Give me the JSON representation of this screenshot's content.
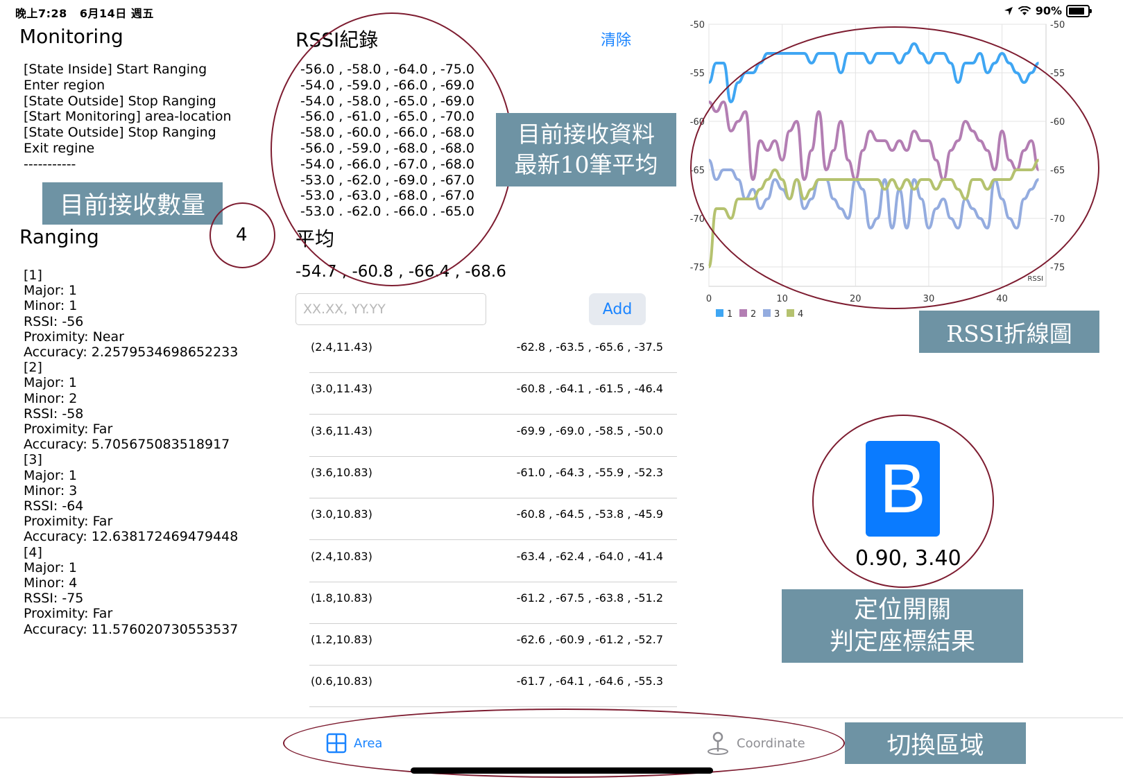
{
  "status_bar": {
    "time": "晚上7:28",
    "date": "6月14日 週五",
    "battery": "90%",
    "battery_level": 0.9
  },
  "monitoring": {
    "title": "Monitoring",
    "log": "[State Inside] Start Ranging\nEnter region\n[State Outside] Stop Ranging\n[Start Monitoring] area-location\n[State Outside] Stop Ranging\nExit regine\n-----------"
  },
  "ranging": {
    "title": "Ranging",
    "count": "4",
    "text": "[1]\nMajor: 1\nMinor: 1\nRSSI: -56\nProximity: Near\nAccuracy: 2.2579534698652233\n[2]\nMajor: 1\nMinor: 2\nRSSI: -58\nProximity: Far\nAccuracy: 5.705675083518917\n[3]\nMajor: 1\nMinor: 3\nRSSI: -64\nProximity: Far\nAccuracy: 12.638172469479448\n[4]\nMajor: 1\nMinor: 4\nRSSI: -75\nProximity: Far\nAccuracy: 11.576020730553537"
  },
  "rssi_log": {
    "title": "RSSI紀錄",
    "clear_label": "清除",
    "lines": "-56.0 , -58.0 , -64.0 , -75.0\n-54.0 , -59.0 , -66.0 , -69.0\n-54.0 , -58.0 , -65.0 , -69.0\n-56.0 , -61.0 , -65.0 , -70.0\n-58.0 , -60.0 , -66.0 , -68.0\n-56.0 , -59.0 , -68.0 , -68.0\n-54.0 , -66.0 , -67.0 , -68.0\n-53.0 , -62.0 , -69.0 , -67.0\n-53.0 , -63.0 , -68.0 , -67.0\n-53.0 , -62.0 , -66.0 , -65.0"
  },
  "average": {
    "title": "平均",
    "values": "-54.7 , -60.8 , -66.4 , -68.6"
  },
  "add_form": {
    "placeholder": "XX.XX, YY.YY",
    "add_label": "Add"
  },
  "records": [
    {
      "coord": "(2.4,11.43)",
      "values": "-62.8 , -63.5 , -65.6 , -37.5"
    },
    {
      "coord": "(3.0,11.43)",
      "values": "-60.8 , -64.1 , -61.5 , -46.4"
    },
    {
      "coord": "(3.6,11.43)",
      "values": "-69.9 , -69.0 , -58.5 , -50.0"
    },
    {
      "coord": "(3.6,10.83)",
      "values": "-61.0 , -64.3 , -55.9 , -52.3"
    },
    {
      "coord": "(3.0,10.83)",
      "values": "-60.8 , -64.5 , -53.8 , -45.9"
    },
    {
      "coord": "(2.4,10.83)",
      "values": "-63.4 , -62.4 , -64.0 , -41.4"
    },
    {
      "coord": "(1.8,10.83)",
      "values": "-61.2 , -67.5 , -63.8 , -51.2"
    },
    {
      "coord": "(1.2,10.83)",
      "values": "-62.6 , -60.9 , -61.2 , -52.7"
    },
    {
      "coord": "(0.6,10.83)",
      "values": "-61.7 , -64.1 , -64.6 , -55.3"
    }
  ],
  "callouts": {
    "count_label": "目前接收數量",
    "data_label_line1": "目前接收資料",
    "data_label_line2": "最新10筆平均",
    "chart_label": "RSSI折線圖",
    "locate_line1": "定位開關",
    "locate_line2": "判定座標結果",
    "tab_label": "切換區域"
  },
  "locate": {
    "logo_letter": "B",
    "result": "0.90, 3.40"
  },
  "tabs": [
    {
      "label": "Area",
      "icon": "grid-icon",
      "active": true
    },
    {
      "label": "Coordinate",
      "icon": "location-pin-icon",
      "active": false
    }
  ],
  "colors": {
    "accent": "#1a84ff",
    "callout": "#6e93a4",
    "ring": "#7d1c30"
  },
  "chart_data": {
    "type": "line",
    "ylim": [
      -77,
      -50
    ],
    "xlim": [
      0,
      46
    ],
    "y_ticks": [
      -50,
      -55,
      -60,
      -65,
      -70,
      -75
    ],
    "x_ticks": [
      0,
      10,
      20,
      30,
      40
    ],
    "axis_label": "RSSI",
    "legend_position": "bottom-left",
    "series": [
      {
        "name": "1",
        "color": "#3fa6f3",
        "values": [
          -56,
          -54,
          -54,
          -58,
          -56,
          -55,
          -55,
          -54,
          -53,
          -53,
          -53,
          -53,
          -53,
          -53,
          -54,
          -53,
          -53,
          -53,
          -55,
          -53,
          -53,
          -53,
          -54,
          -53,
          -53,
          -53,
          -54,
          -53,
          -52,
          -53,
          -54,
          -53,
          -53,
          -54,
          -56,
          -54,
          -54,
          -53,
          -55,
          -54,
          -53,
          -54,
          -55,
          -56,
          -55,
          -54
        ]
      },
      {
        "name": "2",
        "color": "#b37eb3",
        "values": [
          -58,
          -59,
          -58,
          -61,
          -60,
          -59,
          -66,
          -62,
          -63,
          -62,
          -64,
          -61,
          -60,
          -66,
          -63,
          -59,
          -65,
          -63,
          -60,
          -64,
          -66,
          -63,
          -61,
          -62,
          -62,
          -63,
          -62,
          -63,
          -61,
          -62,
          -62,
          -64,
          -66,
          -63,
          -62,
          -60,
          -61,
          -62,
          -63,
          -65,
          -61,
          -64,
          -65,
          -63,
          -62,
          -65
        ]
      },
      {
        "name": "3",
        "color": "#94acdf",
        "values": [
          -64,
          -66,
          -65,
          -65,
          -66,
          -68,
          -67,
          -69,
          -68,
          -66,
          -67,
          -68,
          -66,
          -69,
          -68,
          -66,
          -66,
          -68,
          -69,
          -70,
          -66,
          -67,
          -71,
          -70,
          -66,
          -71,
          -67,
          -71,
          -66,
          -68,
          -71,
          -69,
          -68,
          -70,
          -71,
          -68,
          -69,
          -70,
          -71,
          -66,
          -68,
          -70,
          -71,
          -68,
          -67,
          -66
        ]
      },
      {
        "name": "4",
        "color": "#b5c26f",
        "values": [
          -75,
          -69,
          -69,
          -70,
          -68,
          -68,
          -68,
          -67,
          -66,
          -65,
          -66,
          -68,
          -66,
          -68,
          -67,
          -66,
          -66,
          -66,
          -66,
          -66,
          -66,
          -66,
          -66,
          -66,
          -67,
          -66,
          -67,
          -66,
          -67,
          -66,
          -66,
          -67,
          -66,
          -66,
          -67,
          -68,
          -66,
          -66,
          -67,
          -66,
          -66,
          -66,
          -65,
          -65,
          -65,
          -64
        ]
      }
    ]
  }
}
